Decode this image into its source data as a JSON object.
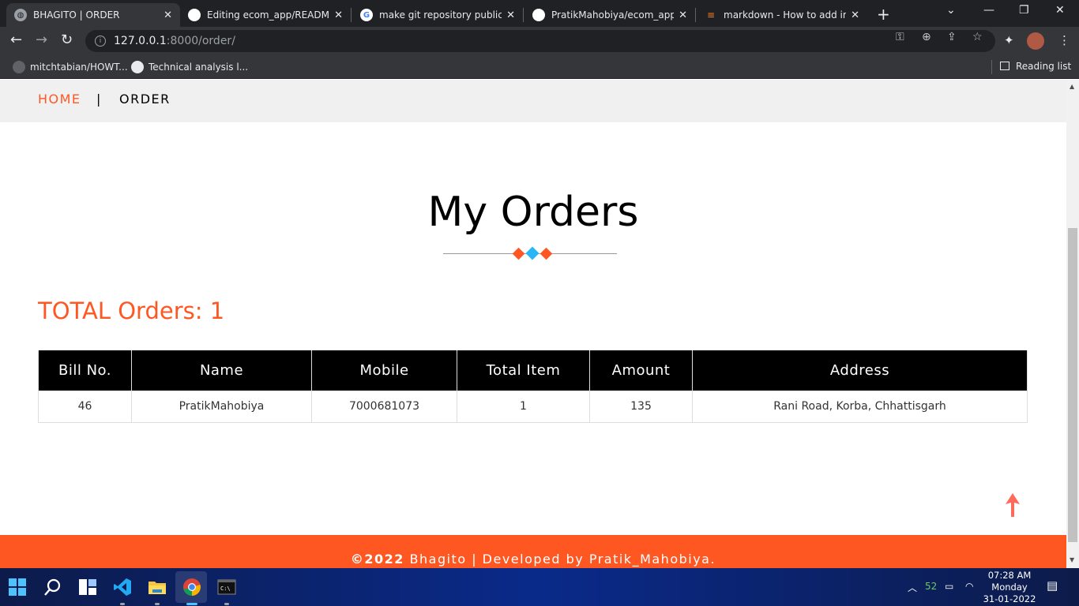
{
  "browser": {
    "tabs": [
      {
        "title": "BHAGITO | ORDER",
        "active": true
      },
      {
        "title": "Editing ecom_app/README.n",
        "active": false
      },
      {
        "title": "make git repository public - (",
        "active": false
      },
      {
        "title": "PratikMahobiya/ecom_app: (",
        "active": false
      },
      {
        "title": "markdown - How to add ima",
        "active": false
      }
    ],
    "url_host": "127.0.0.1",
    "url_path": ":8000/order/",
    "bookmarks": [
      "mitchtabian/HOWT...",
      "Technical analysis l..."
    ],
    "reading_list": "Reading list"
  },
  "nav": {
    "home": "HOME",
    "separator": "|",
    "order": "ORDER"
  },
  "page": {
    "heading": "My Orders",
    "total_orders": "TOTAL Orders: 1"
  },
  "table": {
    "headers": [
      "Bill No.",
      "Name",
      "Mobile",
      "Total Item",
      "Amount",
      "Address"
    ],
    "rows": [
      [
        "46",
        "PratikMahobiya",
        "7000681073",
        "1",
        "135",
        "Rani Road, Korba, Chhattisgarh"
      ]
    ]
  },
  "footer": {
    "copyright": "©2022",
    "text": " Bhagito | Developed by Pratik_Mahobiya."
  },
  "taskbar": {
    "tray_number": "52",
    "time": "07:28 AM",
    "day": "Monday",
    "date": "31-01-2022"
  },
  "colors": {
    "accent": "#ff5722",
    "diamond_accent": "#29b6f6"
  }
}
